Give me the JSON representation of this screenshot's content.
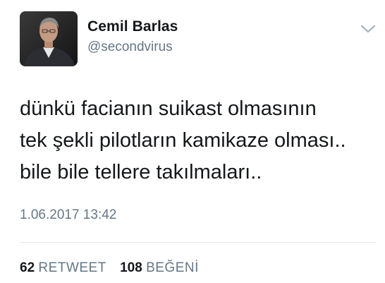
{
  "author": {
    "name": "Cemil Barlas",
    "handle": "@secondvirus"
  },
  "tweet": {
    "lines": [
      "dünkü facianın suikast olmasının",
      "tek şekli pilotların kamikaze olması..",
      "bile bile tellere takılmaları.."
    ],
    "timestamp": "1.06.2017 13:42"
  },
  "stats": {
    "retweets_count": "62",
    "retweets_label": "RETWEET",
    "likes_count": "108",
    "likes_label": "BEĞENİ"
  },
  "icons": {
    "menu": "chevron-down-icon"
  },
  "colors": {
    "primary_text": "#14171a",
    "secondary_text": "#657786",
    "divider": "#e1e8ed"
  }
}
